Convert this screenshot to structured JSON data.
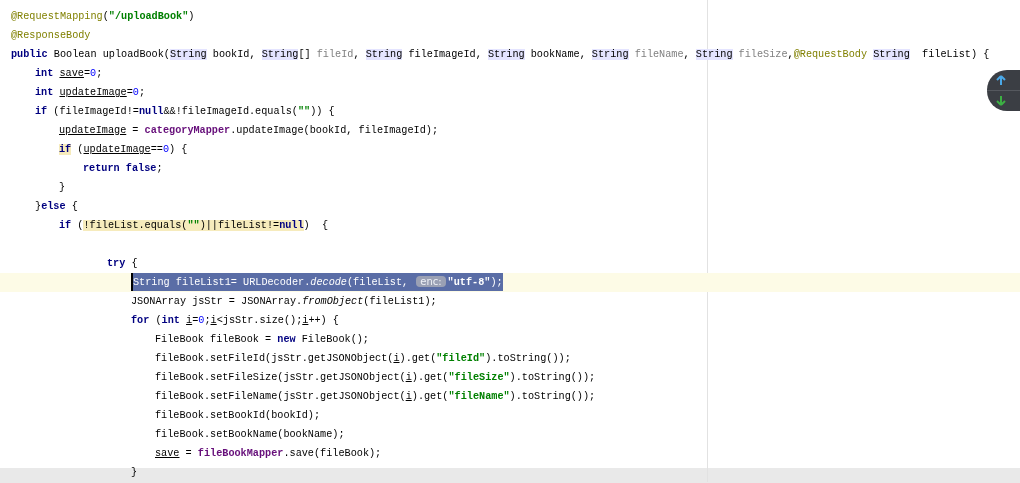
{
  "editor": {
    "lines": [
      {
        "current": false,
        "tokens": [
          {
            "text": "@RequestMapping",
            "kind": "ann"
          },
          {
            "text": "(",
            "kind": "p"
          },
          {
            "text": "\"/uploadBook\"",
            "kind": "str"
          },
          {
            "text": ")",
            "kind": "p"
          }
        ]
      },
      {
        "current": false,
        "tokens": [
          {
            "text": "@ResponseBody",
            "kind": "ann"
          }
        ]
      },
      {
        "current": false,
        "tokens": [
          {
            "text": "public",
            "kind": "kw"
          },
          {
            "text": " Boolean uploadBook(",
            "kind": "p"
          },
          {
            "text": "String",
            "kind": "type"
          },
          {
            "text": " bookId, ",
            "kind": "p"
          },
          {
            "text": "String",
            "kind": "type"
          },
          {
            "text": "[] ",
            "kind": "p"
          },
          {
            "text": "fileId",
            "kind": "unused"
          },
          {
            "text": ", ",
            "kind": "p"
          },
          {
            "text": "String",
            "kind": "type"
          },
          {
            "text": " fileImageId, ",
            "kind": "p"
          },
          {
            "text": "String",
            "kind": "type"
          },
          {
            "text": " bookName, ",
            "kind": "p"
          },
          {
            "text": "String",
            "kind": "type"
          },
          {
            "text": " fileName",
            "kind": "unused"
          },
          {
            "text": ", ",
            "kind": "p"
          },
          {
            "text": "String",
            "kind": "type"
          },
          {
            "text": " fileSize",
            "kind": "unused"
          },
          {
            "text": ",",
            "kind": "p"
          },
          {
            "text": "@RequestBody ",
            "kind": "ann"
          },
          {
            "text": "String",
            "kind": "type"
          },
          {
            "text": "  fileList) {",
            "kind": "p"
          }
        ],
        "children": [
          {
            "current": false,
            "tokens": [
              {
                "text": "int ",
                "kind": "kw"
              },
              {
                "text": "save",
                "kind": "var"
              },
              {
                "text": "=",
                "kind": "p"
              },
              {
                "text": "0",
                "kind": "num"
              },
              {
                "text": ";",
                "kind": "p"
              }
            ]
          },
          {
            "current": false,
            "tokens": [
              {
                "text": "int ",
                "kind": "kw"
              },
              {
                "text": "updateImage",
                "kind": "var"
              },
              {
                "text": "=",
                "kind": "p"
              },
              {
                "text": "0",
                "kind": "num"
              },
              {
                "text": ";",
                "kind": "p"
              }
            ]
          },
          {
            "current": false,
            "tokens": [
              {
                "text": "if",
                "kind": "kw"
              },
              {
                "text": " (fileImageId!=",
                "kind": "p"
              },
              {
                "text": "null",
                "kind": "kw"
              },
              {
                "text": "&&!fileImageId.equals(",
                "kind": "p"
              },
              {
                "text": "\"\"",
                "kind": "str"
              },
              {
                "text": ")) {",
                "kind": "p"
              }
            ],
            "children": [
              {
                "current": false,
                "tokens": [
                  {
                    "text": "updateImage",
                    "kind": "var"
                  },
                  {
                    "text": " = ",
                    "kind": "p"
                  },
                  {
                    "text": "categoryMapper",
                    "kind": "field"
                  },
                  {
                    "text": ".updateImage(bookId, fileImageId);",
                    "kind": "p"
                  }
                ]
              },
              {
                "current": false,
                "tokens": [
                  {
                    "kind": "flagged",
                    "tokens": [
                      {
                        "text": "if",
                        "kind": "kw"
                      }
                    ]
                  },
                  {
                    "text": " (",
                    "kind": "p"
                  },
                  {
                    "text": "updateImage",
                    "kind": "var"
                  },
                  {
                    "text": "==",
                    "kind": "p"
                  },
                  {
                    "text": "0",
                    "kind": "num"
                  },
                  {
                    "text": ") {",
                    "kind": "p"
                  }
                ],
                "children": [
                  {
                    "current": false,
                    "tokens": [
                      {
                        "text": "return ",
                        "kind": "kw"
                      },
                      {
                        "text": "false",
                        "kind": "kw"
                      },
                      {
                        "text": ";",
                        "kind": "p"
                      }
                    ]
                  }
                ]
              },
              {
                "current": false,
                "tokens": [
                  {
                    "text": "}",
                    "kind": "p"
                  }
                ]
              }
            ]
          },
          {
            "current": false,
            "tokens": [
              {
                "text": "}",
                "kind": "p"
              },
              {
                "text": "else",
                "kind": "kw"
              },
              {
                "text": " {",
                "kind": "p"
              }
            ],
            "children": [
              {
                "current": false,
                "tokens": [
                  {
                    "text": "if",
                    "kind": "kw"
                  },
                  {
                    "text": " (",
                    "kind": "p"
                  },
                  {
                    "kind": "flagged",
                    "tokens": [
                      {
                        "text": "!fileList.equals(",
                        "kind": "p"
                      },
                      {
                        "text": "\"\"",
                        "kind": "str"
                      },
                      {
                        "text": ")||fileList!=",
                        "kind": "p"
                      },
                      {
                        "text": "null",
                        "kind": "kw"
                      }
                    ]
                  },
                  {
                    "text": ")  {",
                    "kind": "p"
                  }
                ],
                "children": [
                  {
                    "current": false,
                    "children": [
                      {
                        "current": false,
                        "tokens": [
                          {
                            "text": "try",
                            "kind": "kw"
                          },
                          {
                            "text": " {",
                            "kind": "p"
                          }
                        ],
                        "children": [
                          {
                            "current": true,
                            "tokens": [
                              {
                                "kind": "selection",
                                "tokens": [
                                  {
                                    "text": "String fileList1= URLDecoder.",
                                    "kind": "p"
                                  },
                                  {
                                    "text": "decode",
                                    "kind": "italic"
                                  },
                                  {
                                    "text": "(fileList, ",
                                    "kind": "p"
                                  },
                                  {
                                    "text": "enc:",
                                    "kind": "hint"
                                  },
                                  {
                                    "text": "\"utf-8\"",
                                    "kind": "str"
                                  },
                                  {
                                    "text": ");",
                                    "kind": "p"
                                  }
                                ]
                              }
                            ]
                          },
                          {
                            "current": false,
                            "tokens": [
                              {
                                "text": "JSONArray jsStr = JSONArray.",
                                "kind": "p"
                              },
                              {
                                "text": "fromObject",
                                "kind": "italic"
                              },
                              {
                                "text": "(fileList1);",
                                "kind": "p"
                              }
                            ]
                          },
                          {
                            "current": false,
                            "tokens": [
                              {
                                "text": "for",
                                "kind": "kw"
                              },
                              {
                                "text": " (",
                                "kind": "p"
                              },
                              {
                                "text": "int ",
                                "kind": "kw"
                              },
                              {
                                "text": "i",
                                "kind": "var"
                              },
                              {
                                "text": "=",
                                "kind": "p"
                              },
                              {
                                "text": "0",
                                "kind": "num"
                              },
                              {
                                "text": ";",
                                "kind": "p"
                              },
                              {
                                "text": "i",
                                "kind": "var"
                              },
                              {
                                "text": "<jsStr.size();",
                                "kind": "p"
                              },
                              {
                                "text": "i",
                                "kind": "var"
                              },
                              {
                                "text": "++) {",
                                "kind": "p"
                              }
                            ],
                            "children": [
                              {
                                "current": false,
                                "tokens": [
                                  {
                                    "text": "FileBook fileBook = ",
                                    "kind": "p"
                                  },
                                  {
                                    "text": "new",
                                    "kind": "kw"
                                  },
                                  {
                                    "text": " FileBook();",
                                    "kind": "p"
                                  }
                                ]
                              },
                              {
                                "current": false,
                                "tokens": [
                                  {
                                    "text": "fileBook.setFileId(jsStr.getJSONObject(",
                                    "kind": "p"
                                  },
                                  {
                                    "text": "i",
                                    "kind": "var"
                                  },
                                  {
                                    "text": ").get(",
                                    "kind": "p"
                                  },
                                  {
                                    "text": "\"fileId\"",
                                    "kind": "str"
                                  },
                                  {
                                    "text": ").toString());",
                                    "kind": "p"
                                  }
                                ]
                              },
                              {
                                "current": false,
                                "tokens": [
                                  {
                                    "text": "fileBook.setFileSize(jsStr.getJSONObject(",
                                    "kind": "p"
                                  },
                                  {
                                    "text": "i",
                                    "kind": "var"
                                  },
                                  {
                                    "text": ").get(",
                                    "kind": "p"
                                  },
                                  {
                                    "text": "\"fileSize\"",
                                    "kind": "str"
                                  },
                                  {
                                    "text": ").toString());",
                                    "kind": "p"
                                  }
                                ]
                              },
                              {
                                "current": false,
                                "tokens": [
                                  {
                                    "text": "fileBook.setFileName(jsStr.getJSONObject(",
                                    "kind": "p"
                                  },
                                  {
                                    "text": "i",
                                    "kind": "var"
                                  },
                                  {
                                    "text": ").get(",
                                    "kind": "p"
                                  },
                                  {
                                    "text": "\"fileName\"",
                                    "kind": "str"
                                  },
                                  {
                                    "text": ").toString());",
                                    "kind": "p"
                                  }
                                ]
                              },
                              {
                                "current": false,
                                "tokens": [
                                  {
                                    "text": "fileBook.setBookId(bookId);",
                                    "kind": "p"
                                  }
                                ]
                              },
                              {
                                "current": false,
                                "tokens": [
                                  {
                                    "text": "fileBook.setBookName(bookName);",
                                    "kind": "p"
                                  }
                                ]
                              },
                              {
                                "current": false,
                                "tokens": [
                                  {
                                    "text": "save",
                                    "kind": "var"
                                  },
                                  {
                                    "text": " = ",
                                    "kind": "p"
                                  },
                                  {
                                    "text": "fileBookMapper",
                                    "kind": "field"
                                  },
                                  {
                                    "text": ".save(fileBook);",
                                    "kind": "p"
                                  }
                                ]
                              }
                            ]
                          },
                          {
                            "current": false,
                            "tokens": [
                              {
                                "text": "}",
                                "kind": "p"
                              }
                            ]
                          }
                        ]
                      }
                    ]
                  }
                ]
              }
            ]
          }
        ]
      }
    ]
  },
  "navigator": {
    "buttons": [
      {
        "kind": "up"
      },
      {
        "kind": "down"
      }
    ]
  }
}
